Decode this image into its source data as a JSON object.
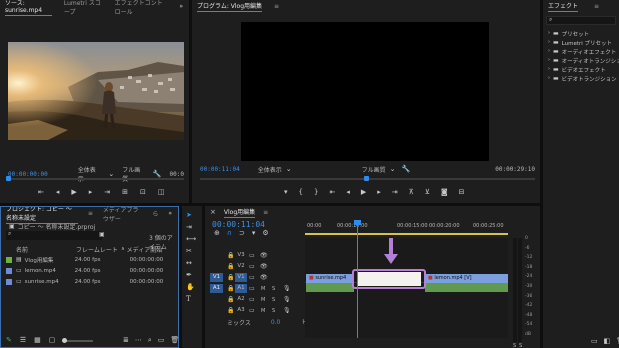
{
  "source": {
    "tabs": [
      "ソース: sunrise.mp4",
      "Lumetri スコープ",
      "エフェクトコントロール"
    ],
    "more": "»",
    "timecode_left": "00:00:00:00",
    "zoom": "全体表示",
    "quality": "フル画質",
    "timecode_right": "00:0"
  },
  "program": {
    "title": "プログラム: Vlog用編集",
    "menu": "≡",
    "timecode_left": "00:00:11:04",
    "zoom": "全体表示",
    "quality": "フル画質",
    "timecode_right": "00:00:29:10"
  },
  "effects": {
    "title": "エフェクト",
    "menu": "≡",
    "search_placeholder": "",
    "items": [
      "プリセット",
      "Lumetri プリセット",
      "オーディオエフェクト",
      "オーディオトランジション",
      "ビデオエフェクト",
      "ビデオトランジション"
    ]
  },
  "project": {
    "tabs": [
      "プロジェクト: コピー 〜 名称未設定",
      "メディアブラウザー",
      "ら"
    ],
    "more": "»",
    "path": "コピー 〜 名称未設定.prproj",
    "item_count": "3 個のアイテム",
    "columns": [
      "名前",
      "フレームレート",
      "メディア開始"
    ],
    "rows": [
      {
        "name": "Vlog用編集",
        "fps": "24.00 fps",
        "start": "00:00:00:00",
        "color": "#6cb142"
      },
      {
        "name": "lemon.mp4",
        "fps": "24.00 fps",
        "start": "00:00:00:00",
        "color": "#6f8bd6"
      },
      {
        "name": "sunrise.mp4",
        "fps": "24.00 fps",
        "start": "00:00:00:00",
        "color": "#6f8bd6"
      }
    ]
  },
  "timeline": {
    "title": "Vlog用編集",
    "menu": "≡",
    "timecode": "00:00:11:04",
    "ruler": [
      "00:00",
      "00:00:10:00",
      "00:00:15:00",
      "00:00:20:00",
      "00:00:25:00"
    ],
    "video_tracks": [
      "V3",
      "V2",
      "V1"
    ],
    "audio_tracks": [
      "A1",
      "A2",
      "A3"
    ],
    "source_patch": [
      "V1",
      "A1"
    ],
    "mix_label": "ミックス",
    "mix_value": "0.0",
    "clips": {
      "sunrise": "sunrise.mp4",
      "lemon": "lemon.mp4 [V]"
    },
    "highlight_color": "#b57fd6",
    "meter_scale": [
      "0",
      "-6",
      "-12",
      "-18",
      "-24",
      "-30",
      "-36",
      "-42",
      "-48",
      "-54",
      "dB"
    ],
    "meter_s": [
      "S",
      "S"
    ]
  },
  "colors": {
    "accent": "#2c8df0",
    "video_clip": "#7b9fdc",
    "audio_clip": "#5f9a4f"
  }
}
